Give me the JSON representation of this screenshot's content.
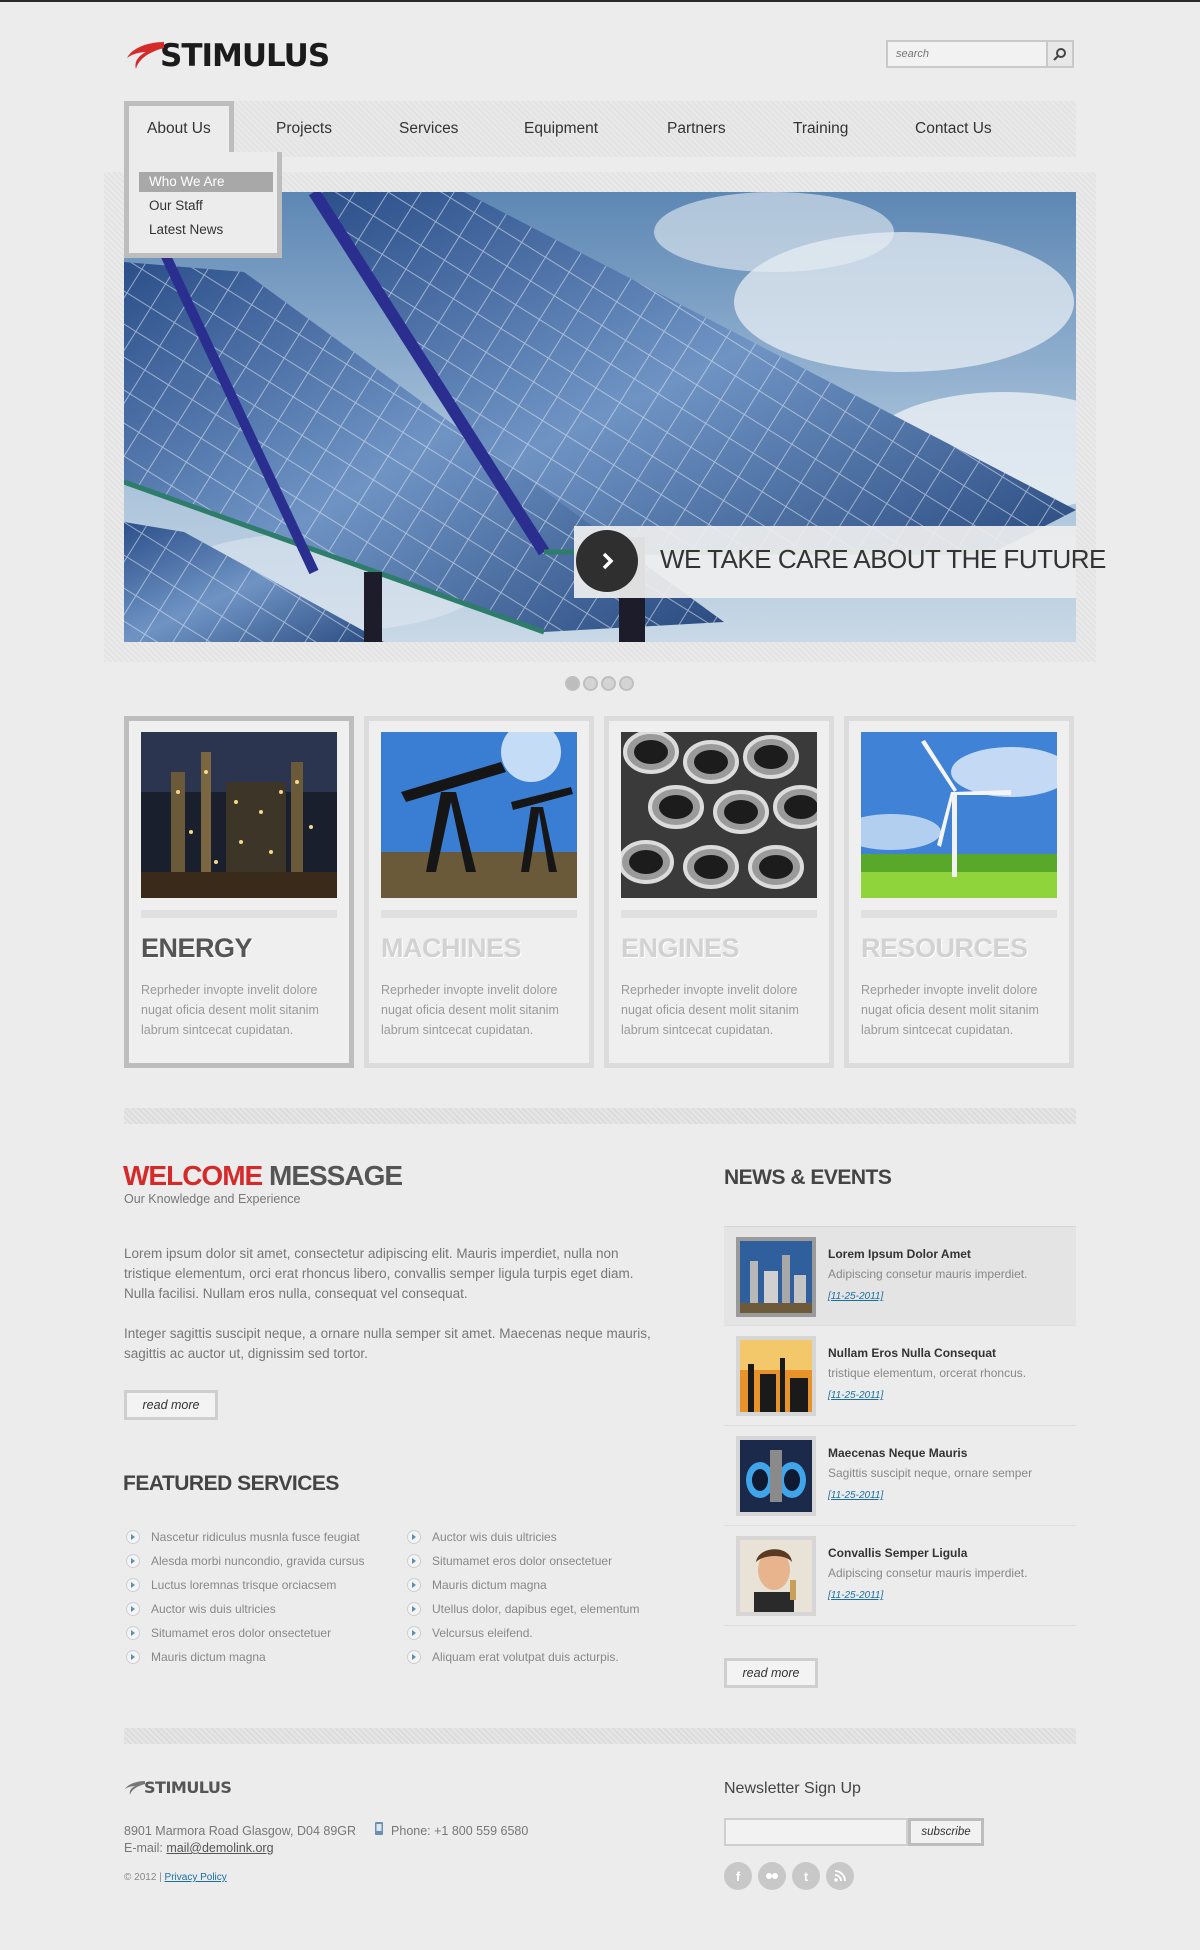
{
  "header": {
    "logo_text": "STIMULUS",
    "search_placeholder": "search"
  },
  "nav": {
    "items": [
      "About Us",
      "Projects",
      "Services",
      "Equipment",
      "Partners",
      "Training",
      "Contact Us"
    ],
    "active": "About Us",
    "dropdown": [
      "Who We Are",
      "Our Staff",
      "Latest News"
    ],
    "dropdown_selected": "Who We Are"
  },
  "slider": {
    "caption": "WE TAKE CARE ABOUT THE FUTURE",
    "dots": 4,
    "active_dot": 0
  },
  "features": [
    {
      "title": "ENERGY",
      "text": "Reprheder invopte invelit dolore nugat oficia desent molit sitanim labrum sintcecat cupidatan.",
      "image": "refinery-night",
      "active": true
    },
    {
      "title": "MACHINES",
      "text": "Reprheder invopte invelit dolore nugat oficia desent molit sitanim labrum sintcecat cupidatan.",
      "image": "oil-pumps",
      "active": false
    },
    {
      "title": "ENGINES",
      "text": "Reprheder invopte invelit dolore nugat oficia desent molit sitanim labrum sintcecat cupidatan.",
      "image": "steel-pipes",
      "active": false
    },
    {
      "title": "RESOURCES",
      "text": "Reprheder invopte invelit dolore nugat oficia desent molit sitanim labrum sintcecat cupidatan.",
      "image": "wind-turbine",
      "active": false
    }
  ],
  "welcome": {
    "title_highlight": "WELCOME",
    "title_rest": " MESSAGE",
    "subtitle": "Our Knowledge and Experience",
    "para1": "Lorem ipsum dolor sit amet, consectetur adipiscing elit. Mauris imperdiet, nulla non tristique elementum, orci erat rhoncus libero, convallis semper ligula turpis eget diam. Nulla facilisi. Nullam eros nulla, consequat vel consequat.",
    "para2": "Integer sagittis suscipit neque, a ornare nulla semper sit amet. Maecenas neque mauris, sagittis ac auctor ut, dignissim sed tortor.",
    "read_more": "read more"
  },
  "featured_services": {
    "title": "FEATURED SERVICES",
    "col1": [
      "Nascetur ridiculus musnla fusce feugiat",
      "Alesda morbi nuncondio, gravida cursus",
      "Luctus loremnas trisque orciacsem",
      "Auctor wis duis ultricies",
      "Situmamet eros dolor onsectetuer",
      "Mauris dictum magna"
    ],
    "col2": [
      "Auctor wis duis ultricies",
      "Situmamet eros dolor onsectetuer",
      "Mauris dictum magna",
      "Utellus dolor, dapibus eget, elementum",
      "Velcursus eleifend.",
      "Aliquam erat volutpat duis acturpis."
    ]
  },
  "news": {
    "title": "NEWS & EVENTS",
    "items": [
      {
        "headline": "Lorem Ipsum Dolor Amet",
        "text": "Adipiscing consetur mauris imperdiet.",
        "date": "[11-25-2011]",
        "thumb": "refinery-thumb"
      },
      {
        "headline": "Nullam Eros Nulla Consequat",
        "text": "tristique elementum, orcerat rhoncus.",
        "date": "[11-25-2011]",
        "thumb": "plant-sunset-thumb"
      },
      {
        "headline": "Maecenas Neque Mauris",
        "text": "Sagittis suscipit neque, ornare semper",
        "date": "[11-25-2011]",
        "thumb": "pipes-blue-thumb"
      },
      {
        "headline": "Convallis Semper Ligula",
        "text": "Adipiscing consetur mauris imperdiet.",
        "date": "[11-25-2011]",
        "thumb": "person-thumb"
      }
    ],
    "read_more": "read more"
  },
  "footer": {
    "logo_text": "STIMULUS",
    "address": "8901 Marmora Road Glasgow, D04 89GR",
    "phone": "Phone: +1 800 559 6580",
    "email_label": "E-mail: ",
    "email": "mail@demolink.org",
    "copyright": "© 2012 | ",
    "privacy": "Privacy Policy",
    "newsletter_title": "Newsletter Sign Up",
    "subscribe": "subscribe",
    "social": [
      "facebook-icon",
      "flickr-icon",
      "twitter-icon",
      "rss-icon"
    ]
  },
  "colors": {
    "accent": "#d42a2a",
    "link": "#1a6fa0"
  }
}
